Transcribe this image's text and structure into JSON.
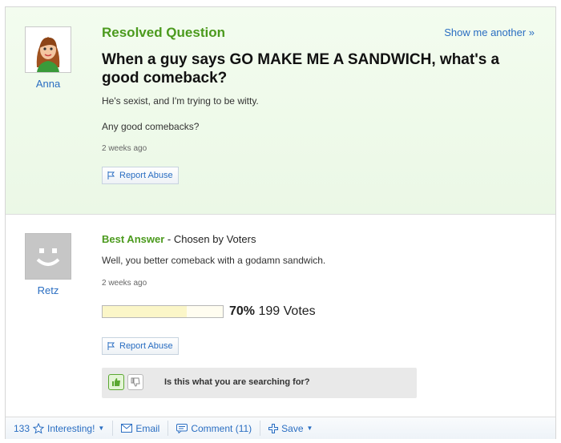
{
  "question": {
    "header": "Resolved Question",
    "show_another": "Show me another »",
    "title": "When a guy says GO MAKE ME A SANDWICH, what's a good comeback?",
    "details": "He's sexist, and I'm trying to be witty.",
    "details2": "Any good comebacks?",
    "time": "2 weeks ago",
    "report": "Report Abuse",
    "user": "Anna"
  },
  "answer": {
    "best_label": "Best Answer",
    "chosen": " - Chosen by Voters",
    "text": "Well, you better comeback with a godamn sandwich.",
    "time": "2 weeks ago",
    "vote_percent_label": "70%",
    "vote_fraction": 0.7,
    "votes": "199 Votes",
    "report": "Report Abuse",
    "user": "Retz",
    "search_question": "Is this what you are searching for?"
  },
  "footer": {
    "count": "133",
    "interesting": "Interesting!",
    "email": "Email",
    "comment": "Comment (11)",
    "save": "Save"
  },
  "colors": {
    "green": "#4b9a1d",
    "link": "#2a6ec2"
  }
}
